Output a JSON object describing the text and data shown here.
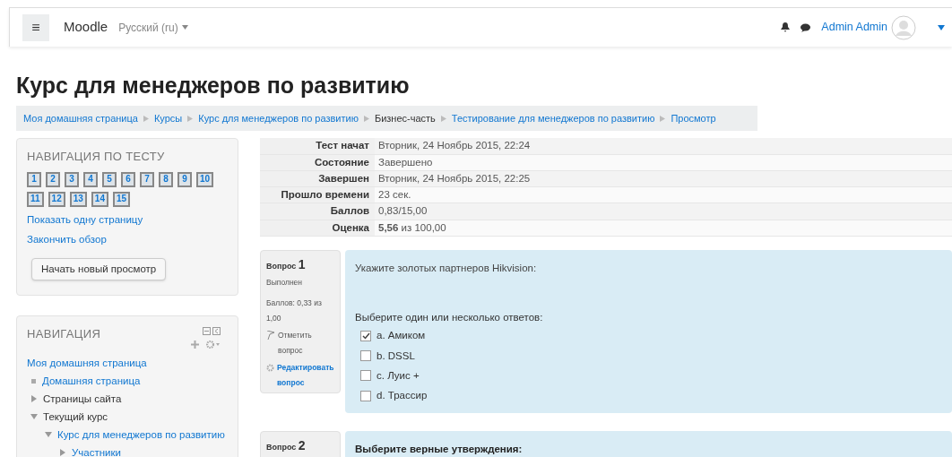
{
  "header": {
    "menu_icon": "≡",
    "brand": "Moodle",
    "language": "Русский (ru)",
    "user": "Admin Admin"
  },
  "page_title": "Курс для менеджеров по развитию",
  "breadcrumb": [
    {
      "label": "Моя домашняя страница",
      "link": true
    },
    {
      "label": "Курсы",
      "link": true
    },
    {
      "label": "Курс для менеджеров по развитию",
      "link": true
    },
    {
      "label": "Бизнес-часть",
      "link": false
    },
    {
      "label": "Тестирование для менеджеров по развитию",
      "link": true
    },
    {
      "label": "Просмотр",
      "link": true
    }
  ],
  "quiz_nav": {
    "title": "НАВИГАЦИЯ ПО ТЕСТУ",
    "questions": [
      "1",
      "2",
      "3",
      "4",
      "5",
      "6",
      "7",
      "8",
      "9",
      "10",
      "11",
      "12",
      "13",
      "14",
      "15"
    ],
    "links": [
      "Показать одну страницу",
      "Закончить обзор"
    ],
    "button": "Начать новый просмотр"
  },
  "navigation": {
    "title": "НАВИГАЦИЯ",
    "items": [
      {
        "label": "Моя домашняя страница",
        "kind": "root",
        "children": [
          {
            "label": "Домашняя страница",
            "kind": "leaf"
          },
          {
            "label": "Страницы сайта",
            "kind": "branch",
            "expanded": false
          },
          {
            "label": "Текущий курс",
            "kind": "branch",
            "expanded": true,
            "children": [
              {
                "label": "Курс для менеджеров по развитию",
                "kind": "branch",
                "expanded": true,
                "link": true,
                "children": [
                  {
                    "label": "Участники",
                    "kind": "branch",
                    "expanded": false,
                    "link": true
                  }
                ]
              }
            ]
          }
        ]
      }
    ]
  },
  "summary": [
    {
      "label": "Тест начат",
      "value": "Вторник, 24 Ноябрь 2015, 22:24"
    },
    {
      "label": "Состояние",
      "value": "Завершено"
    },
    {
      "label": "Завершен",
      "value": "Вторник, 24 Ноябрь 2015, 22:25"
    },
    {
      "label": "Прошло времени",
      "value": "23 сек."
    },
    {
      "label": "Баллов",
      "value": "0,83/15,00"
    },
    {
      "label": "Оценка",
      "value": "**5,56** из 100,00"
    }
  ],
  "questions": [
    {
      "label": "Вопрос",
      "number": "1",
      "status": "Выполнен",
      "score": "Баллов: 0,33 из 1,00",
      "flag": "Отметить вопрос",
      "edit": "Редактировать вопрос",
      "text": "Укажите золотых партнеров Hikvision:",
      "prompt": "Выберите один или несколько ответов:",
      "answers": [
        {
          "label": "a. Амиком",
          "checked": true
        },
        {
          "label": "b. DSSL",
          "checked": false
        },
        {
          "label": "c. Луис +",
          "checked": false
        },
        {
          "label": "d. Трассир",
          "checked": false
        }
      ]
    },
    {
      "label": "Вопрос",
      "number": "2",
      "text": "Выберите верные утверждения:"
    }
  ]
}
